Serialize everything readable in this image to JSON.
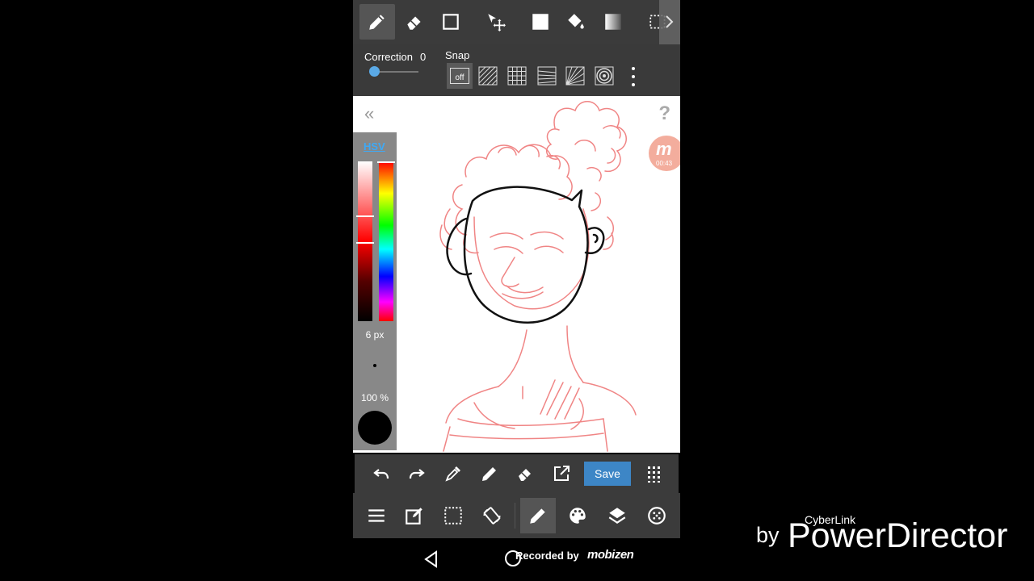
{
  "toolbar": {
    "tools": [
      {
        "name": "pen-tool",
        "icon": "pencil-icon",
        "active": true
      },
      {
        "name": "eraser-tool",
        "icon": "eraser-icon"
      },
      {
        "name": "shape-tool",
        "icon": "rectangle-icon"
      },
      {
        "name": "move-tool",
        "icon": "move-icon"
      },
      {
        "name": "fill-color-tool",
        "icon": "filled-square-icon"
      },
      {
        "name": "bucket-tool",
        "icon": "paint-bucket-icon"
      },
      {
        "name": "gradient-tool",
        "icon": "gradient-icon"
      },
      {
        "name": "select-tool",
        "icon": "selection-icon"
      }
    ]
  },
  "options": {
    "correction_label": "Correction",
    "correction_value": "0",
    "snap_label": "Snap",
    "snap_off_label": "off",
    "snap_modes": [
      "off",
      "parallel",
      "grid",
      "perspective",
      "radial",
      "concentric"
    ]
  },
  "canvas": {
    "rec_badge_time": "00:43"
  },
  "color_panel": {
    "mode_label": "HSV",
    "brush_size": "6 px",
    "opacity": "100 %",
    "current_color": "#000000"
  },
  "action_bar": {
    "save_label": "Save",
    "buttons": [
      "undo",
      "redo",
      "eyedropper",
      "pen",
      "eraser",
      "export",
      "save",
      "grid-menu"
    ]
  },
  "main_nav": {
    "items": [
      "menu",
      "edit",
      "selection",
      "rotate",
      "brush",
      "color",
      "layers",
      "materials"
    ],
    "active": "brush"
  },
  "system_bar": {
    "recorded_by": "Recorded by",
    "brand": "mobizen"
  },
  "watermark": {
    "by": "by",
    "company": "CyberLink",
    "product": "PowerDirector"
  },
  "colors": {
    "toolbar_bg": "#3b3b3b",
    "accent_blue": "#3d86c6",
    "sketch_red": "#f08585"
  }
}
